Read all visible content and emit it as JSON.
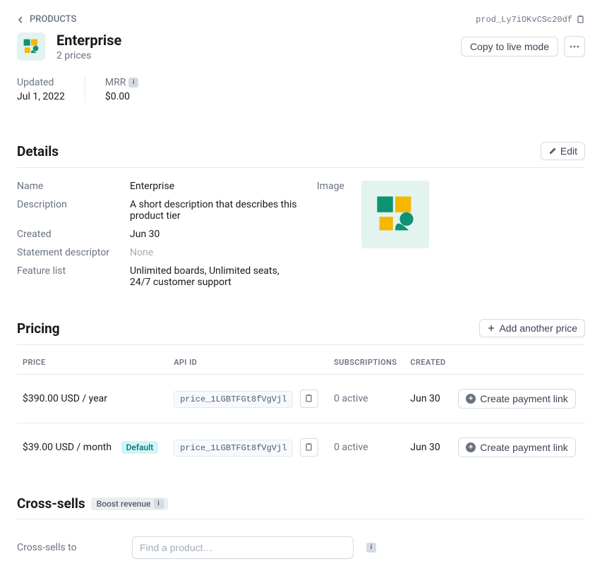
{
  "breadcrumb": "PRODUCTS",
  "productId": "prod_Ly7iOKvCSc20df",
  "header": {
    "title": "Enterprise",
    "subtitle": "2 prices",
    "copyBtn": "Copy to live mode"
  },
  "meta": {
    "updatedLabel": "Updated",
    "updatedValue": "Jul 1, 2022",
    "mrrLabel": "MRR",
    "mrrValue": "$0.00"
  },
  "details": {
    "title": "Details",
    "editBtn": "Edit",
    "nameLabel": "Name",
    "nameValue": "Enterprise",
    "descLabel": "Description",
    "descValue": "A short description that describes this product tier",
    "createdLabel": "Created",
    "createdValue": "Jun 30",
    "stmtLabel": "Statement descriptor",
    "stmtValue": "None",
    "featureLabel": "Feature list",
    "featureValue": "Unlimited boards, Unlimited seats, 24/7 customer support",
    "imageLabel": "Image"
  },
  "pricing": {
    "title": "Pricing",
    "addBtn": "Add another price",
    "headers": {
      "price": "PRICE",
      "api": "API ID",
      "subs": "SUBSCRIPTIONS",
      "created": "CREATED"
    },
    "rows": [
      {
        "price": "$390.00 USD / year",
        "isDefault": false,
        "api": "price_1LGBTFGt8fVgVjl",
        "subs": "0 active",
        "created": "Jun 30",
        "actionLabel": "Create payment link"
      },
      {
        "price": "$39.00 USD / month",
        "isDefault": true,
        "defaultLabel": "Default",
        "api": "price_1LGBTFGt8fVgVjl",
        "subs": "0 active",
        "created": "Jun 30",
        "actionLabel": "Create payment link"
      }
    ]
  },
  "crossSells": {
    "title": "Cross-sells",
    "badge": "Boost revenue",
    "label": "Cross-sells to",
    "placeholder": "Find a product…"
  }
}
